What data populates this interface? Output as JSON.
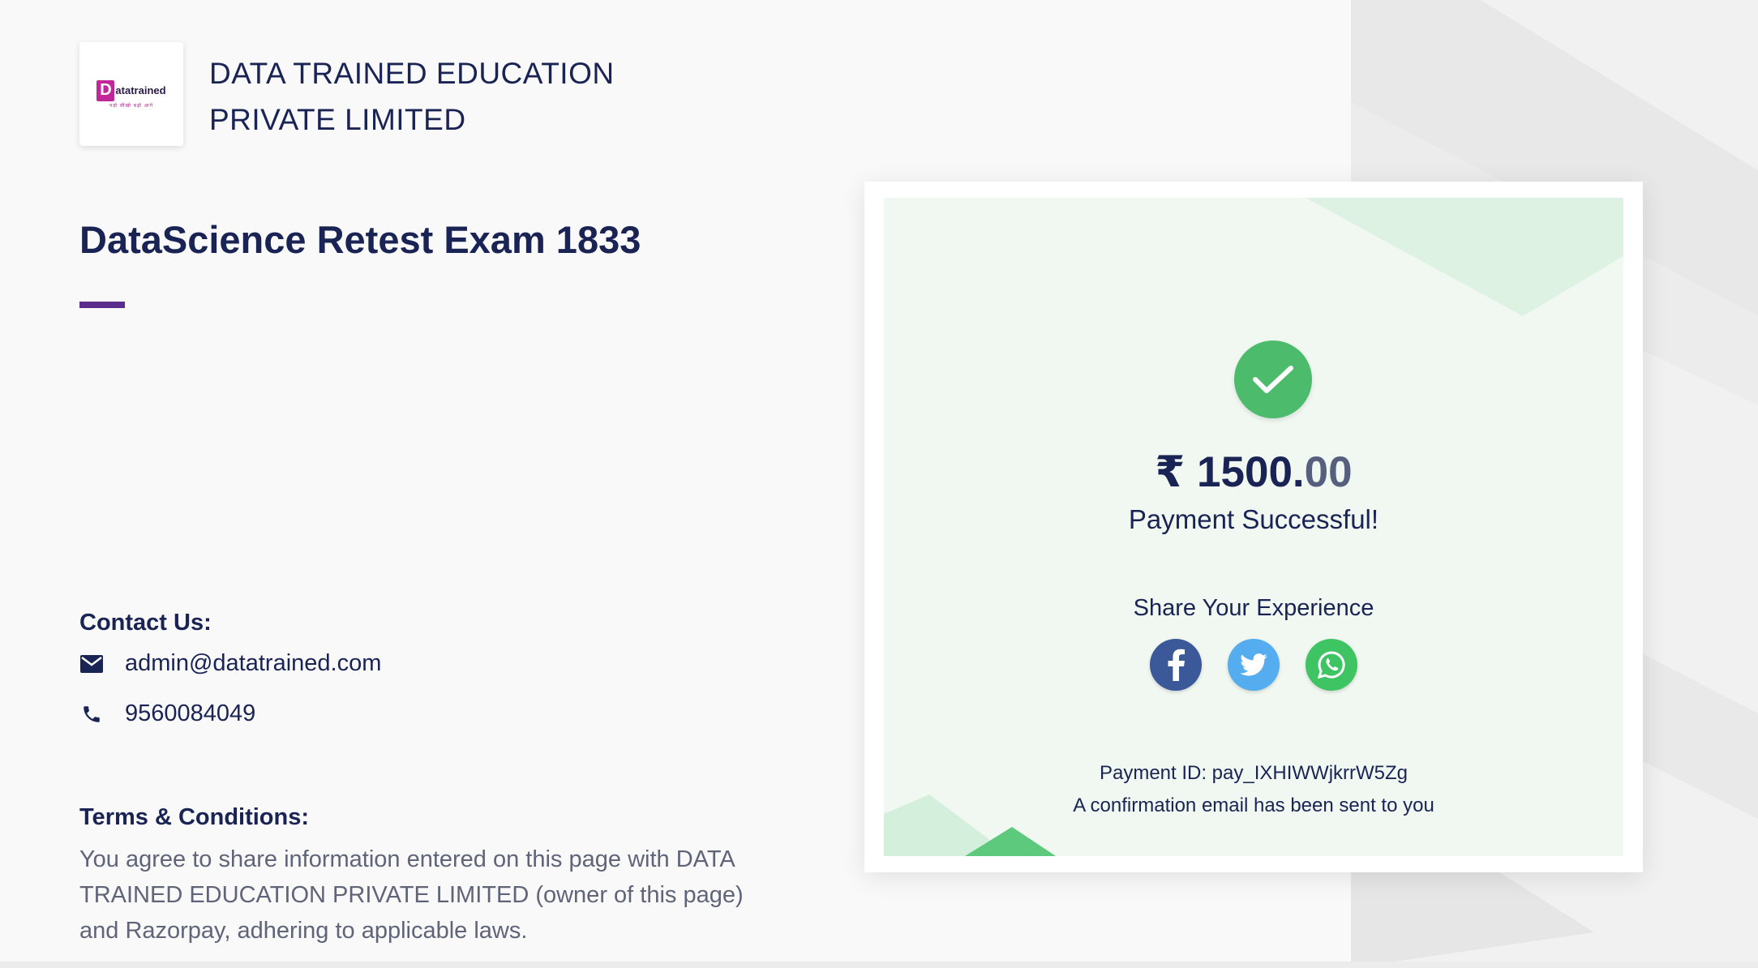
{
  "brand": {
    "logo_letter": "D",
    "logo_word": "atatrained",
    "logo_tagline": "पढ़ो सीखो बढ़ो आगे",
    "merchant_line1": "DATA TRAINED EDUCATION",
    "merchant_line2": "PRIVATE LIMITED",
    "accent_color": "#5a2d8c"
  },
  "page": {
    "title": "DataScience Retest Exam 1833"
  },
  "contact": {
    "heading": "Contact Us:",
    "email": "admin@datatrained.com",
    "phone": "9560084049"
  },
  "terms": {
    "heading": "Terms & Conditions:",
    "body": "You agree to share information entered on this page with DATA TRAINED EDUCATION PRIVATE LIMITED (owner of this page) and Razorpay, adhering to applicable laws."
  },
  "payment": {
    "currency_symbol": "₹",
    "amount_whole": "1500.",
    "amount_decimal": "00",
    "status": "Payment Successful!",
    "share_label": "Share Your Experience",
    "payment_id": "Payment ID: pay_IXHIWWjkrrW5Zg",
    "confirmation": "A confirmation email has been sent to you",
    "success_color": "#4cbb6c"
  },
  "social": [
    {
      "name": "facebook-icon",
      "color": "#3b5998"
    },
    {
      "name": "twitter-icon",
      "color": "#55acee"
    },
    {
      "name": "whatsapp-icon",
      "color": "#3fc463"
    }
  ]
}
